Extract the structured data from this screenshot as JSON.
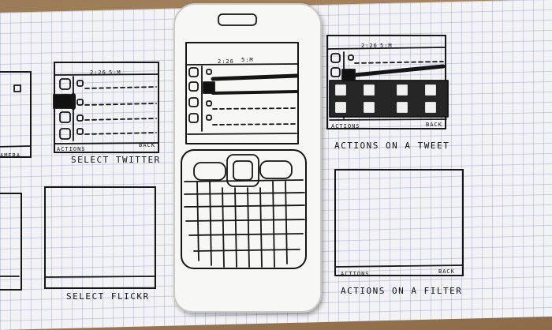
{
  "screens": {
    "left_partial": {
      "bottom_label": "AMERA"
    },
    "twitter": {
      "status_left": "2:26",
      "status_right": "5:M",
      "softkey_left": "ACTIONS",
      "softkey_right": "BACK",
      "caption": "SELECT TWITTER"
    },
    "phone": {
      "status_left": "2:26",
      "status_right": "5:M"
    },
    "tweet": {
      "status_left": "2:26",
      "status_right": "5:M",
      "softkey_left": "ACTIONS",
      "softkey_right": "BACK",
      "caption": "ACTIONS ON A TWEET"
    },
    "flickr": {
      "caption": "SELECT FLICKR"
    },
    "filter": {
      "softkey_left": "ACTIONS",
      "softkey_right": "BACK",
      "caption": "ACTIONS ON A FILTER"
    }
  }
}
